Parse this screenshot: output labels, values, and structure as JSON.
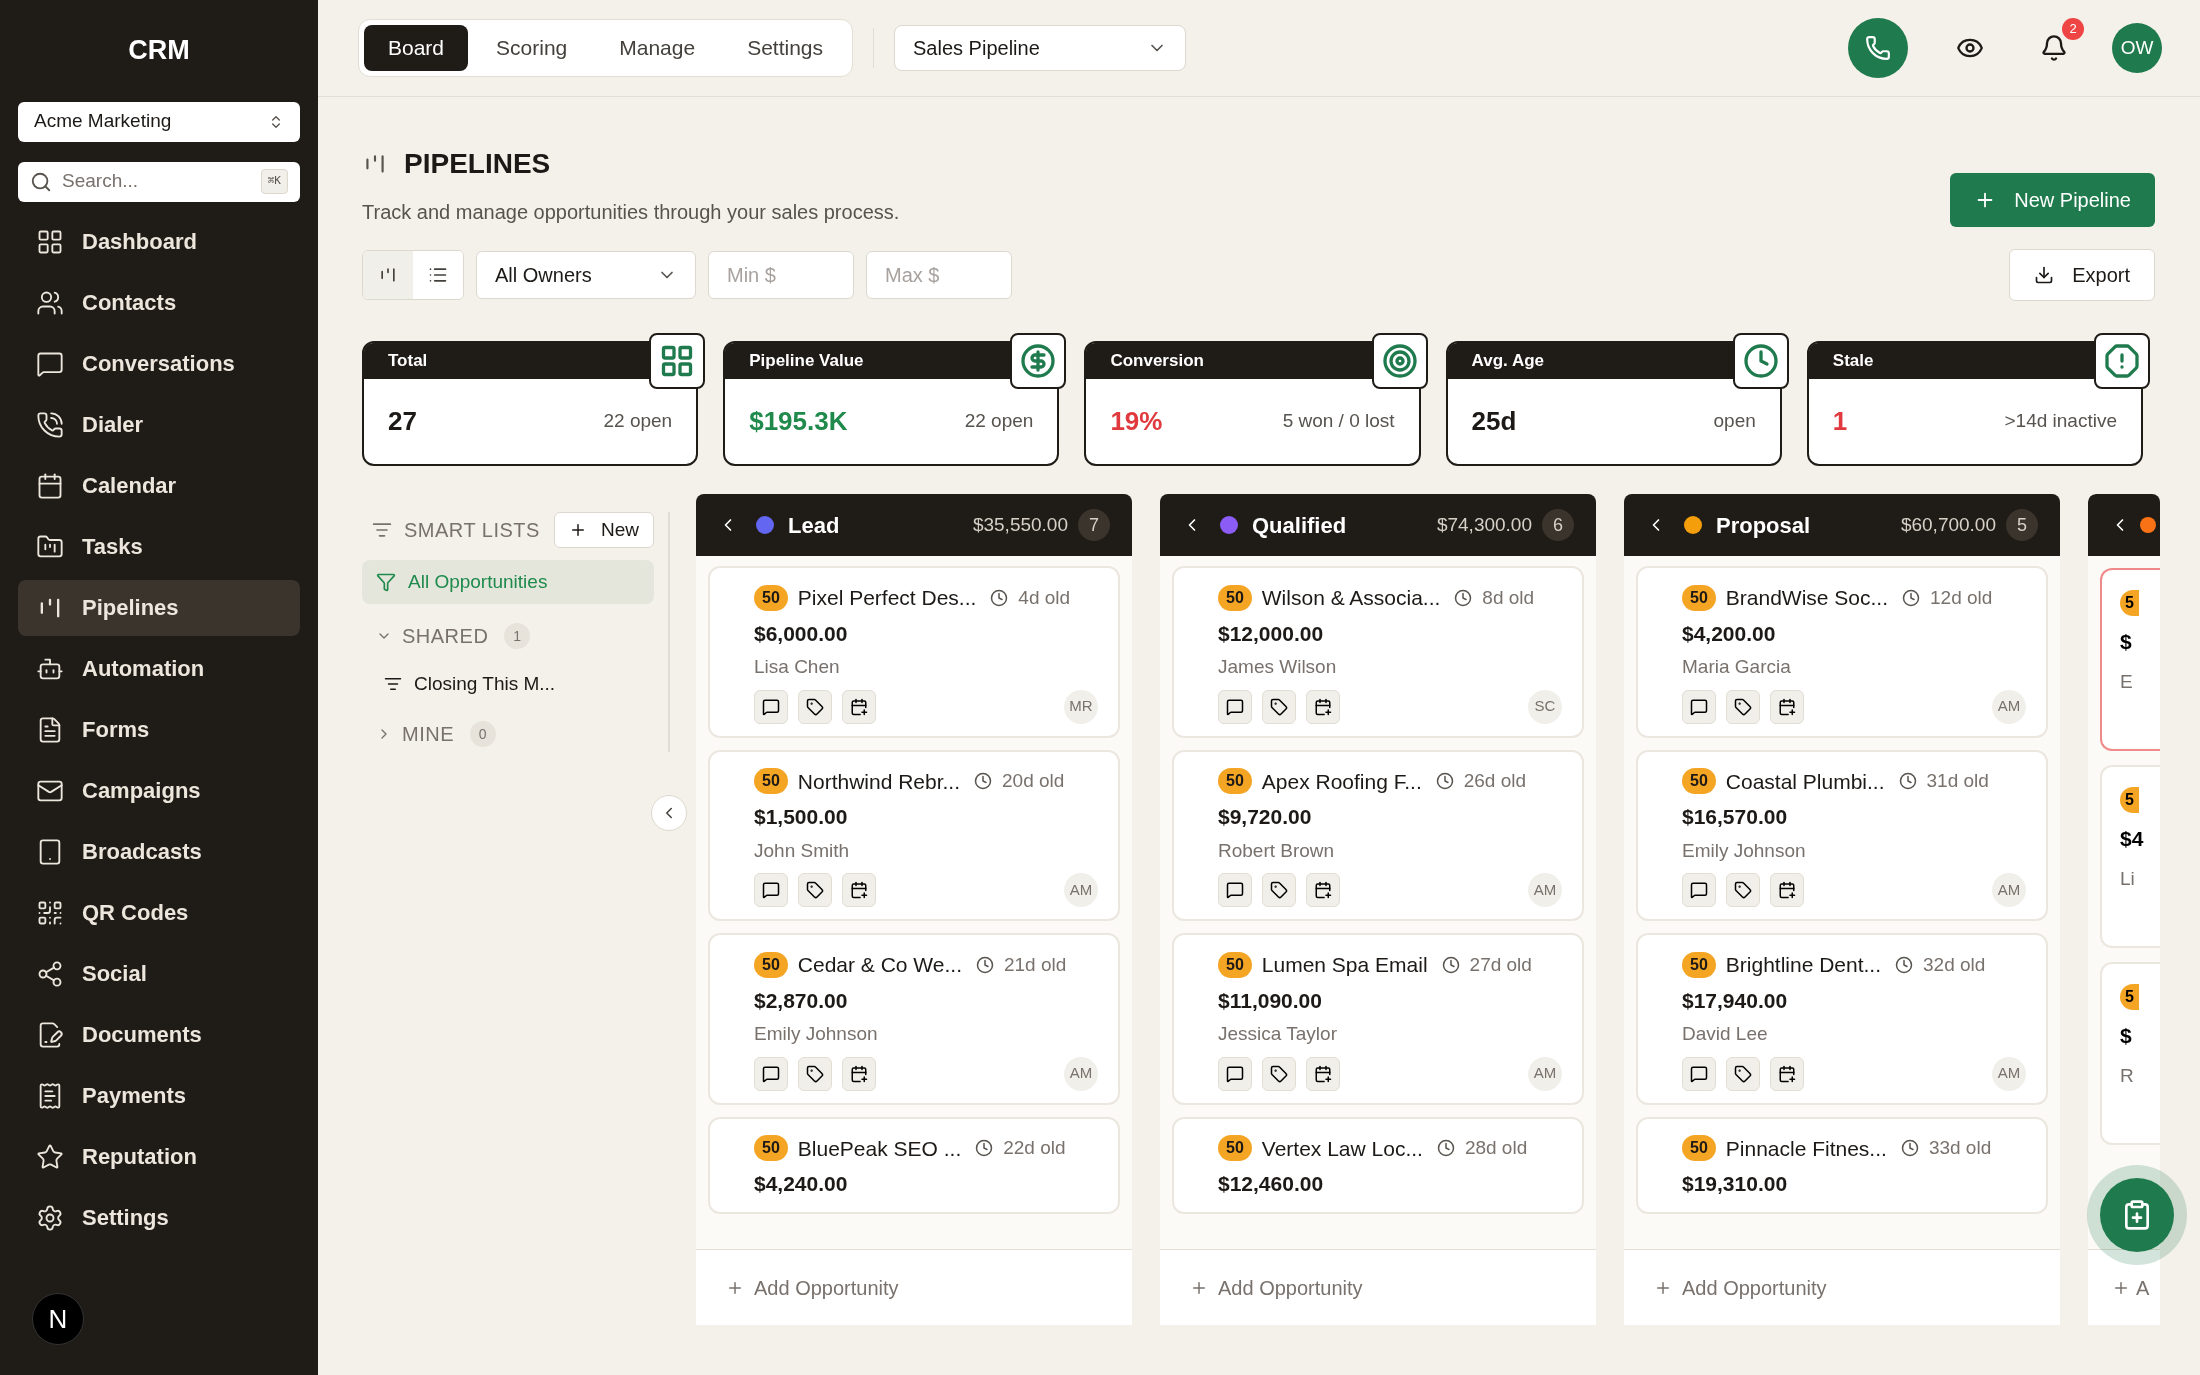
{
  "sidebar": {
    "brand": "CRM",
    "workspace": "Acme Marketing",
    "search": {
      "placeholder": "Search...",
      "shortcut": "⌘K"
    },
    "items": [
      {
        "label": "Dashboard",
        "selected": false
      },
      {
        "label": "Contacts",
        "selected": false
      },
      {
        "label": "Conversations",
        "selected": false
      },
      {
        "label": "Dialer",
        "selected": false
      },
      {
        "label": "Calendar",
        "selected": false
      },
      {
        "label": "Tasks",
        "selected": false
      },
      {
        "label": "Pipelines",
        "selected": true
      },
      {
        "label": "Automation",
        "selected": false
      },
      {
        "label": "Forms",
        "selected": false
      },
      {
        "label": "Campaigns",
        "selected": false
      },
      {
        "label": "Broadcasts",
        "selected": false
      },
      {
        "label": "QR Codes",
        "selected": false
      },
      {
        "label": "Social",
        "selected": false
      },
      {
        "label": "Documents",
        "selected": false
      },
      {
        "label": "Payments",
        "selected": false
      },
      {
        "label": "Reputation",
        "selected": false
      },
      {
        "label": "Settings",
        "selected": false
      }
    ],
    "avatar": "N"
  },
  "topbar": {
    "tabs": [
      {
        "label": "Board",
        "selected": true
      },
      {
        "label": "Scoring",
        "selected": false
      },
      {
        "label": "Manage",
        "selected": false
      },
      {
        "label": "Settings",
        "selected": false
      }
    ],
    "pipeline_select": "Sales Pipeline",
    "notifications": "2",
    "user": "OW"
  },
  "header": {
    "title": "PIPELINES",
    "subtitle": "Track and manage opportunities through your sales process.",
    "new_button": "New Pipeline"
  },
  "toolbar": {
    "views": [
      {
        "kind": "board",
        "selected": true
      },
      {
        "kind": "list",
        "selected": false
      }
    ],
    "owner": "All Owners",
    "min": {
      "placeholder": "Min $"
    },
    "max": {
      "placeholder": "Max $"
    },
    "export": "Export"
  },
  "stats": [
    {
      "label": "Total",
      "value": "27",
      "sub": "22 open",
      "color": "#1c1917"
    },
    {
      "label": "Pipeline Value",
      "value": "$195.3K",
      "sub": "22 open",
      "color": "#1f8a4c"
    },
    {
      "label": "Conversion",
      "value": "19%",
      "sub": "5 won / 0 lost",
      "color": "#e0393e"
    },
    {
      "label": "Avg. Age",
      "value": "25d",
      "sub": "open",
      "color": "#1c1917"
    },
    {
      "label": "Stale",
      "value": "1",
      "sub": ">14d inactive",
      "color": "#e0393e"
    }
  ],
  "smart_lists": {
    "title": "SMART LISTS",
    "new": "New",
    "items": [
      {
        "label": "All Opportunities",
        "selected": true
      }
    ],
    "groups": [
      {
        "label": "SHARED",
        "count": "1",
        "expanded": true,
        "items": [
          {
            "label": "Closing This M..."
          }
        ]
      },
      {
        "label": "MINE",
        "count": "0",
        "expanded": false
      }
    ]
  },
  "stages": [
    {
      "name": "Lead",
      "color": "#6366f1",
      "total": "$35,550.00",
      "count": "7",
      "add": "Add Opportunity",
      "cards": [
        {
          "score": "50",
          "title": "Pixel Perfect Des...",
          "age": "4d old",
          "amount": "$6,000.00",
          "contact": "Lisa Chen",
          "owner": "MR"
        },
        {
          "score": "50",
          "title": "Northwind Rebr...",
          "age": "20d old",
          "amount": "$1,500.00",
          "contact": "John Smith",
          "owner": "AM"
        },
        {
          "score": "50",
          "title": "Cedar & Co We...",
          "age": "21d old",
          "amount": "$2,870.00",
          "contact": "Emily Johnson",
          "owner": "AM"
        },
        {
          "score": "50",
          "title": "BluePeak SEO ...",
          "age": "22d old",
          "amount": "$4,240.00"
        }
      ]
    },
    {
      "name": "Qualified",
      "color": "#8b5cf6",
      "total": "$74,300.00",
      "count": "6",
      "add": "Add Opportunity",
      "cards": [
        {
          "score": "50",
          "title": "Wilson & Associa...",
          "age": "8d old",
          "amount": "$12,000.00",
          "contact": "James Wilson",
          "owner": "SC"
        },
        {
          "score": "50",
          "title": "Apex Roofing F...",
          "age": "26d old",
          "amount": "$9,720.00",
          "contact": "Robert Brown",
          "owner": "AM"
        },
        {
          "score": "50",
          "title": "Lumen Spa Email",
          "age": "27d old",
          "amount": "$11,090.00",
          "contact": "Jessica Taylor",
          "owner": "AM"
        },
        {
          "score": "50",
          "title": "Vertex Law Loc...",
          "age": "28d old",
          "amount": "$12,460.00"
        }
      ]
    },
    {
      "name": "Proposal",
      "color": "#f59e0b",
      "total": "$60,700.00",
      "count": "5",
      "add": "Add Opportunity",
      "cards": [
        {
          "score": "50",
          "title": "BrandWise Soc...",
          "age": "12d old",
          "amount": "$4,200.00",
          "contact": "Maria Garcia",
          "owner": "AM"
        },
        {
          "score": "50",
          "title": "Coastal Plumbi...",
          "age": "31d old",
          "amount": "$16,570.00",
          "contact": "Emily Johnson",
          "owner": "AM"
        },
        {
          "score": "50",
          "title": "Brightline Dent...",
          "age": "32d old",
          "amount": "$17,940.00",
          "contact": "David Lee",
          "owner": "AM"
        },
        {
          "score": "50",
          "title": "Pinnacle Fitnes...",
          "age": "33d old",
          "amount": "$19,310.00"
        }
      ]
    },
    {
      "kind": "partial",
      "color": "#f97316",
      "add": "A",
      "cards": [
        {
          "score": "5",
          "amount": "$",
          "contact": "E",
          "highlighted": true
        },
        {
          "score": "5",
          "amount": "$4",
          "contact": "Li",
          "highlighted": false
        },
        {
          "score": "5",
          "amount": "$",
          "contact": "R",
          "highlighted": false
        }
      ]
    }
  ]
}
